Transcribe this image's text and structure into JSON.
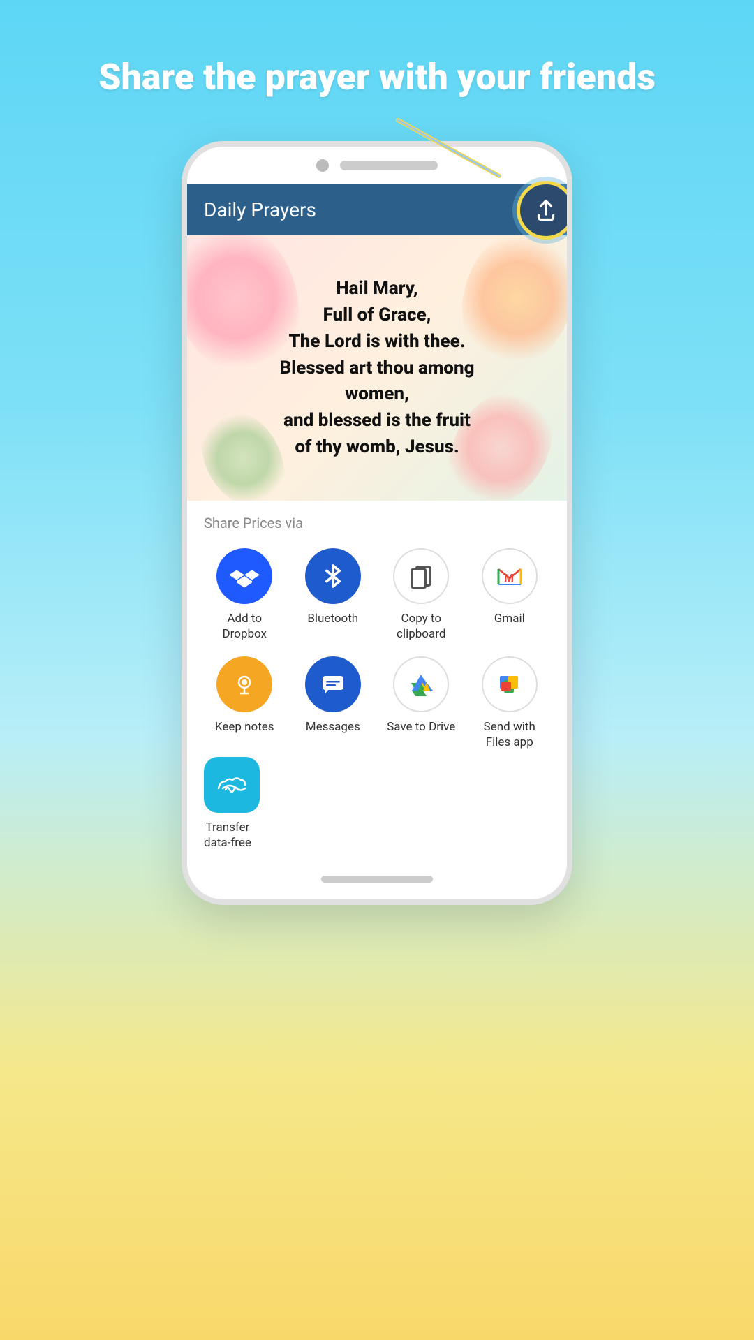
{
  "headline": "Share the prayer with your friends",
  "app": {
    "title": "Daily Prayers",
    "share_label": "Share Prices via",
    "prayer_text": "Hail Mary,\nFull of Grace,\nThe Lord is with thee.\nBlessed art thou among women,\nand blessed is the fruit\nof thy womb, Jesus.",
    "share_button_label": "Share"
  },
  "share_items": [
    {
      "id": "dropbox",
      "label": "Add to\nDropbox",
      "icon_class": "icon-dropbox",
      "icon": "dropbox"
    },
    {
      "id": "bluetooth",
      "label": "Bluetooth",
      "icon_class": "icon-bluetooth",
      "icon": "bluetooth"
    },
    {
      "id": "clipboard",
      "label": "Copy to\nclipboard",
      "icon_class": "icon-clipboard",
      "icon": "clipboard"
    },
    {
      "id": "gmail",
      "label": "Gmail",
      "icon_class": "icon-gmail",
      "icon": "gmail"
    },
    {
      "id": "keep",
      "label": "Keep notes",
      "icon_class": "icon-keep",
      "icon": "keep"
    },
    {
      "id": "messages",
      "label": "Messages",
      "icon_class": "icon-messages",
      "icon": "messages"
    },
    {
      "id": "drive",
      "label": "Save to Drive",
      "icon_class": "icon-drive",
      "icon": "drive"
    },
    {
      "id": "files",
      "label": "Send with\nFiles app",
      "icon_class": "icon-files",
      "icon": "files"
    }
  ],
  "transfer_item": {
    "label": "Transfer\ndata-free",
    "icon_class": "icon-transfer"
  }
}
